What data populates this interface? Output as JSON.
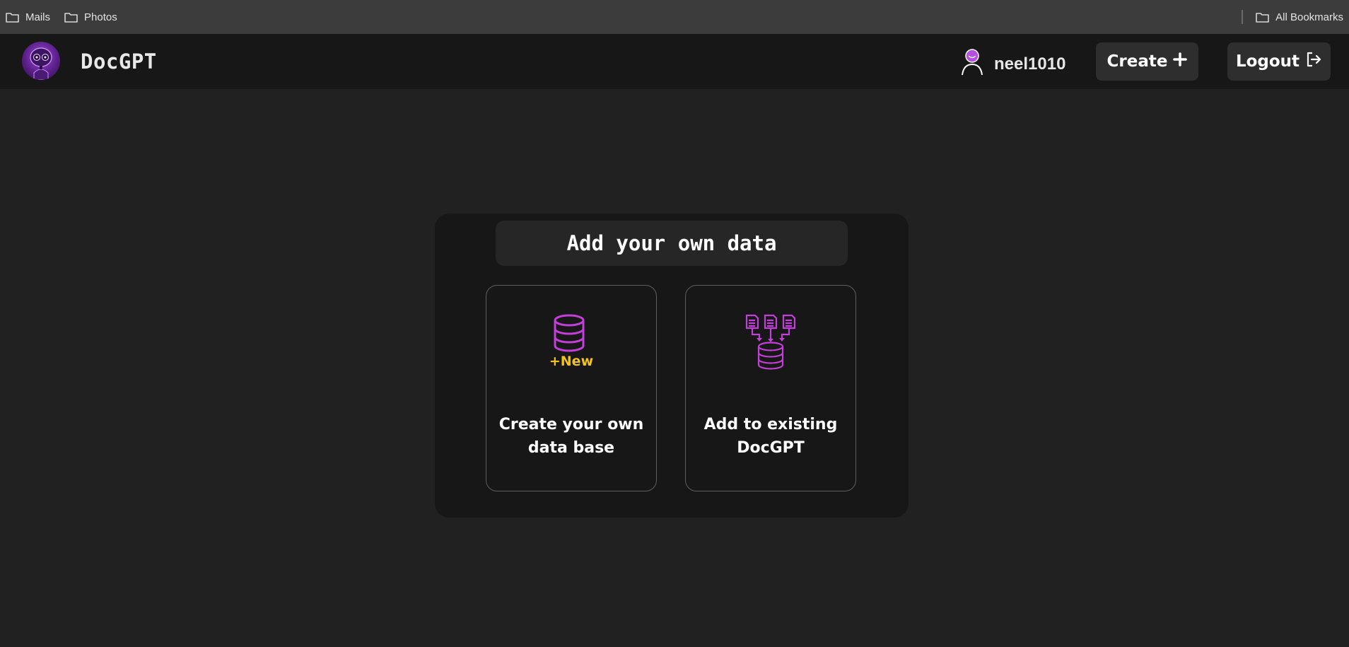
{
  "bookmarks": {
    "items": [
      {
        "label": "Mails",
        "icon": "folder-icon"
      },
      {
        "label": "Photos",
        "icon": "folder-icon"
      }
    ],
    "all_bookmarks": "All Bookmarks"
  },
  "navbar": {
    "brand": "DocGPT",
    "username": "neel1010",
    "create_label": "Create",
    "logout_label": "Logout"
  },
  "main": {
    "title": "Add your own data",
    "options": [
      {
        "label_line1": "Create your own",
        "label_line2": "data base",
        "badge": "+New"
      },
      {
        "label_line1": "Add to existing",
        "label_line2": "DocGPT"
      }
    ]
  },
  "colors": {
    "accent_purple": "#c23fd8",
    "badge_yellow": "#f2c318",
    "background": "#212121",
    "navbar": "#171717",
    "bookmarks_bar": "#3c3c3c"
  }
}
